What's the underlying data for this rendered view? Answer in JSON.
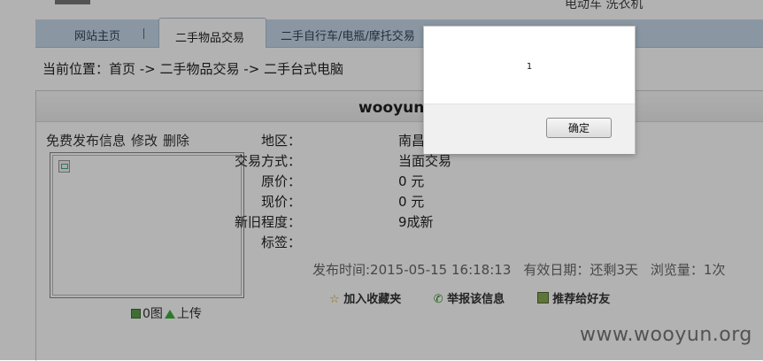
{
  "header": {
    "top_right_text": "电动车 洗衣机"
  },
  "nav": {
    "tabs": [
      {
        "label": "网站主页"
      },
      {
        "label": "二手物品交易",
        "active": true
      },
      {
        "label": "二手自行车/电瓶/摩托交易"
      }
    ]
  },
  "breadcrumb": "当前位置：首页 -> 二手物品交易 -> 二手台式电脑",
  "listing": {
    "title": "wooyunt",
    "actions": {
      "post": "免费发布信息",
      "edit": "修改",
      "delete": "删除"
    },
    "photo_tools": {
      "count": "0图",
      "upload": "上传"
    },
    "fields": [
      {
        "label": "地区：",
        "value": "南昌"
      },
      {
        "label": "交易方式：",
        "value": "当面交易"
      },
      {
        "label": "原价：",
        "value": "0 元"
      },
      {
        "label": "现价：",
        "value": "0 元"
      },
      {
        "label": "新旧程度：",
        "value": "9成新"
      },
      {
        "label": "标签：",
        "value": ""
      }
    ],
    "meta": {
      "posted": "发布时间:2015-05-15 16:18:13",
      "valid": "有效日期：还剩3天",
      "views": "浏览量：1次"
    },
    "links": {
      "favorite": "加入收藏夹",
      "report": "举报该信息",
      "recommend": "推荐给好友"
    }
  },
  "watermark": "www.wooyun.org",
  "dialog": {
    "message": "1",
    "ok_label": "确定"
  }
}
